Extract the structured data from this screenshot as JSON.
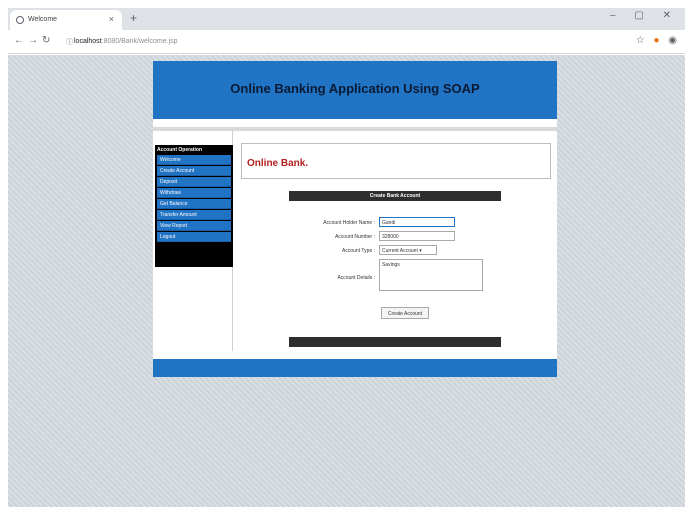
{
  "browser": {
    "tab_title": "Welcome",
    "tab_close": "×",
    "new_tab": "+",
    "window_controls": "–  ▢  ✕",
    "nav": {
      "back": "←",
      "forward": "→",
      "reload": "↻"
    },
    "url_host": "localhost",
    "url_path": ":8080/Bank/welcome.jsp",
    "icons": [
      "tab-favicon-icon",
      "info-icon",
      "star-icon",
      "extension-icon",
      "profile-icon"
    ]
  },
  "page": {
    "banner_title": "Online Banking Application Using SOAP",
    "welcome_text": "Online Bank."
  },
  "sidebar": {
    "header": "Account Operation",
    "items": [
      {
        "label": "Welcome"
      },
      {
        "label": "Create Account"
      },
      {
        "label": "Deposit"
      },
      {
        "label": "Withdraw"
      },
      {
        "label": "Get Balance"
      },
      {
        "label": "Transfer Amount"
      },
      {
        "label": "View Report"
      },
      {
        "label": "Logout"
      }
    ]
  },
  "form": {
    "title": "Create Bank Account",
    "holder_label": "Account Holder Name :",
    "holder_value": "Gandi",
    "number_label": "Account Number :",
    "number_value": "328000",
    "type_label": "Account Type :",
    "type_value": "Current Account ▾",
    "details_label": "Account Details :",
    "details_value": "Savings",
    "submit_label": "Create Account"
  },
  "colors": {
    "accent_blue": "#2173c4",
    "menu_black": "#000000",
    "welcome_red": "#b32020",
    "form_bar": "#2e2e2e",
    "background": "#d4dbe0"
  }
}
